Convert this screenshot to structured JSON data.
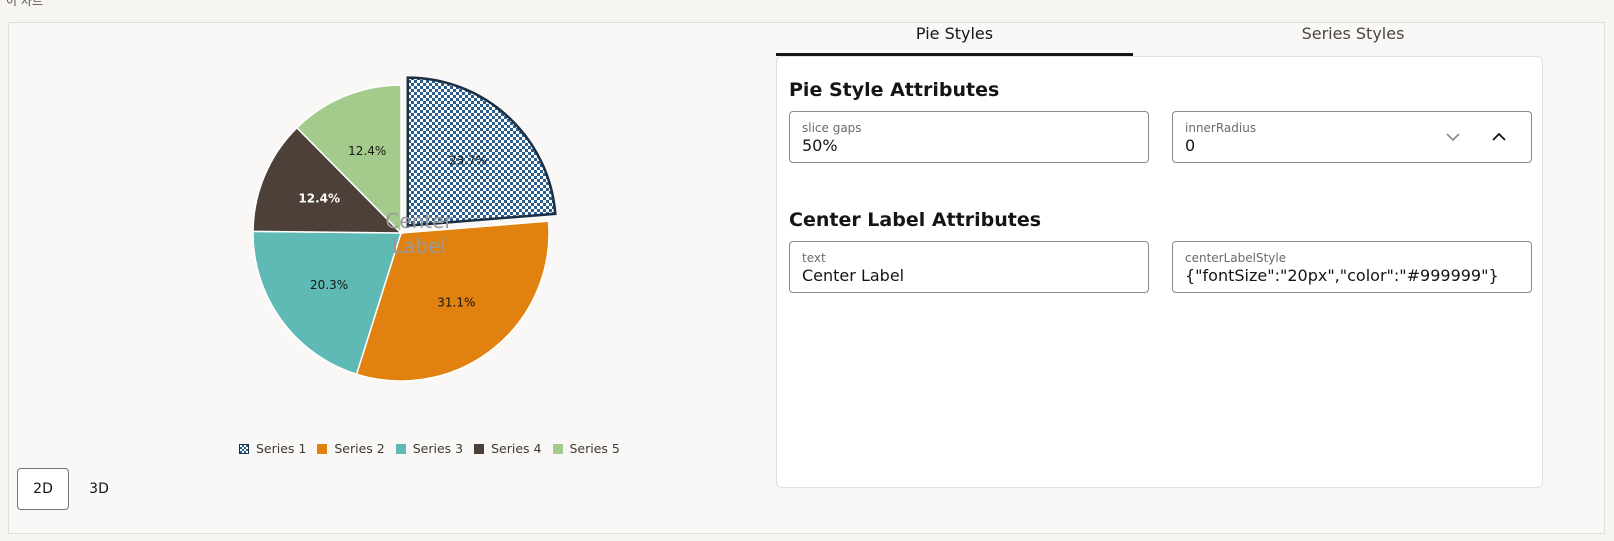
{
  "page": {
    "heading": "이 차트"
  },
  "chart_data": {
    "type": "pie",
    "slices": [
      {
        "name": "Series 1",
        "value": 23.7,
        "label": "23.7%",
        "color": "#2a5f8f",
        "pattern": "checker",
        "exploded": true,
        "selected": true
      },
      {
        "name": "Series 2",
        "value": 31.1,
        "label": "31.1%",
        "color": "#e08110"
      },
      {
        "name": "Series 3",
        "value": 20.3,
        "label": "20.3%",
        "color": "#5fbab6"
      },
      {
        "name": "Series 4",
        "value": 12.4,
        "label": "12.4%",
        "color": "#4d4038"
      },
      {
        "name": "Series 5",
        "value": 12.4,
        "label": "12.4%",
        "color": "#a3cb8b"
      }
    ],
    "center_label": "Center Label",
    "center_label_color": "#999999",
    "legend_position": "bottom"
  },
  "dimension_toggle": {
    "options": [
      "2D",
      "3D"
    ],
    "selected": "2D"
  },
  "tabs": [
    {
      "label": "Pie Styles",
      "active": true
    },
    {
      "label": "Series Styles",
      "active": false
    }
  ],
  "pie_style": {
    "title": "Pie Style Attributes",
    "slice_gaps": {
      "label": "slice gaps",
      "value": "50%"
    },
    "inner_radius": {
      "label": "innerRadius",
      "value": "0"
    }
  },
  "center_label_attrs": {
    "title": "Center Label Attributes",
    "text": {
      "label": "text",
      "value": "Center Label"
    },
    "style": {
      "label": "centerLabelStyle",
      "value": "{\"fontSize\":\"20px\",\"color\":\"#999999\"}"
    }
  }
}
